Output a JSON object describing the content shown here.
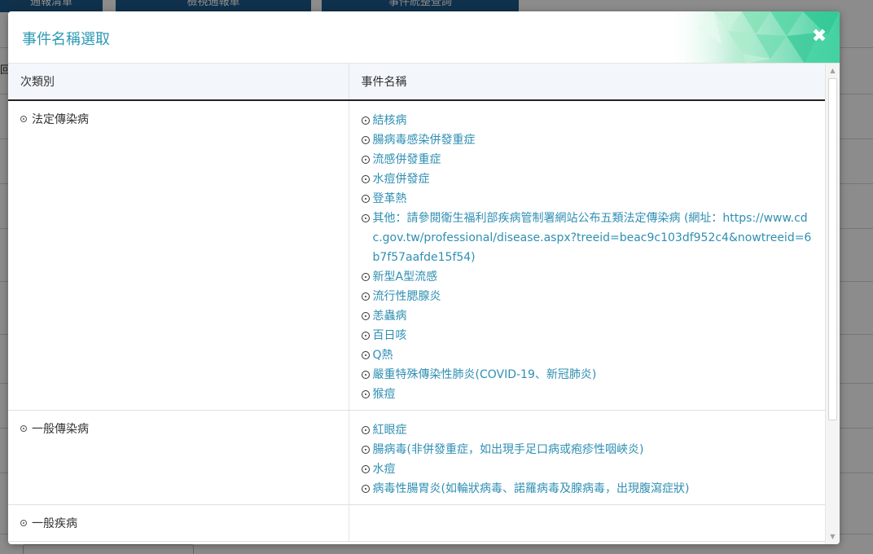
{
  "background": {
    "tabs": [
      "通報清單",
      "檢視通報單",
      "事件統整查詢"
    ],
    "fragment": "回"
  },
  "modal": {
    "title": "事件名稱選取",
    "close_label": "✖",
    "columns": [
      "次類別",
      "事件名稱"
    ],
    "rows": [
      {
        "category": "法定傳染病",
        "events": [
          "結核病",
          "腸病毒感染併發重症",
          "流感併發重症",
          "水痘併發症",
          "登革熱",
          "其他：請參閱衛生福利部疾病管制署網站公布五類法定傳染病 (網址：https://www.cdc.gov.tw/professional/disease.aspx?treeid=beac9c103df952c4&nowtreeid=6b7f57aafde15f54)",
          "新型A型流感",
          "流行性腮腺炎",
          "恙蟲病",
          "百日咳",
          "Q熱",
          "嚴重特殊傳染性肺炎(COVID-19、新冠肺炎)",
          "猴痘"
        ]
      },
      {
        "category": "一般傳染病",
        "events": [
          "紅眼症",
          "腸病毒(非併發重症，如出現手足口病或疱疹性咽峽炎)",
          "水痘",
          "病毒性腸胃炎(如輪狀病毒、諾羅病毒及腺病毒，出現腹瀉症狀)"
        ]
      },
      {
        "category": "一般疾病",
        "events": []
      }
    ]
  },
  "colors": {
    "title": "#2d9ab5",
    "link": "#2f8fb3",
    "header_bg": "#f3f7fb",
    "tab_bg": "#1e5a8a"
  },
  "icons": {
    "category_bullet": "radio-dot-icon",
    "event_bullet": "radio-circle-icon",
    "close": "close-icon"
  }
}
